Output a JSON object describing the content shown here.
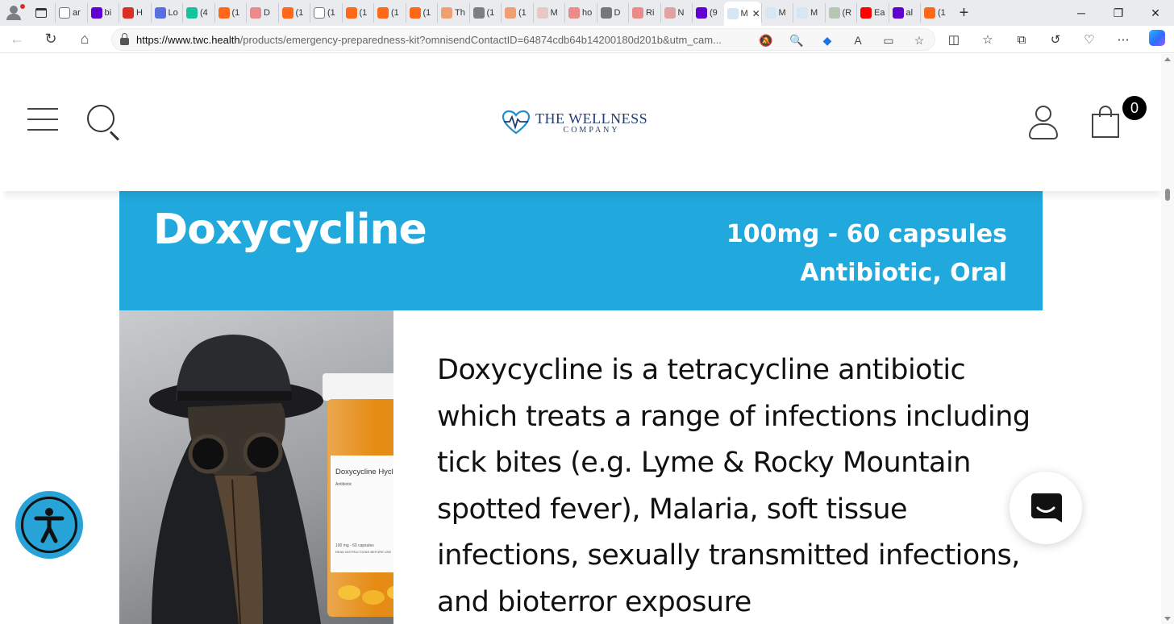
{
  "browser": {
    "tabs": [
      {
        "label": "ar",
        "icon": "document-icon",
        "color": "#ffffff"
      },
      {
        "label": "bi",
        "icon": "yahoo-icon",
        "color": "#6001d2"
      },
      {
        "label": "H",
        "icon": "pocket-icon",
        "color": "#d93025"
      },
      {
        "label": "Lo",
        "icon": "five-icon",
        "color": "#5b6ee1"
      },
      {
        "label": "(4",
        "icon": "g-icon",
        "color": "#15c39a"
      },
      {
        "label": "(1",
        "icon": "substack-icon",
        "color": "#ff6719"
      },
      {
        "label": "D",
        "icon": "youtube-icon",
        "color": "#ea8b8b"
      },
      {
        "label": "(1",
        "icon": "substack-icon",
        "color": "#ff6719"
      },
      {
        "label": "(1",
        "icon": "document-icon",
        "color": "#ffffff"
      },
      {
        "label": "(1",
        "icon": "substack-icon",
        "color": "#ff6719"
      },
      {
        "label": "(1",
        "icon": "substack-icon",
        "color": "#ff6719"
      },
      {
        "label": "(1",
        "icon": "substack-icon",
        "color": "#ff6719"
      },
      {
        "label": "Th",
        "icon": "substack-icon",
        "color": "#f0a070"
      },
      {
        "label": "(1",
        "icon": "image-icon",
        "color": "#7a7f86"
      },
      {
        "label": "(1",
        "icon": "substack-icon",
        "color": "#f0a070"
      },
      {
        "label": "M",
        "icon": "bi-icon",
        "color": "#e6c9c3"
      },
      {
        "label": "ho",
        "icon": "youtube-icon",
        "color": "#ea8b8b"
      },
      {
        "label": "D",
        "icon": "slash-icon",
        "color": "#777777"
      },
      {
        "label": "Ri",
        "icon": "youtube-icon",
        "color": "#ea8b8b"
      },
      {
        "label": "N",
        "icon": "r-icon",
        "color": "#e2a2a2"
      },
      {
        "label": "(9",
        "icon": "mail-icon",
        "color": "#6001d2"
      }
    ],
    "active_tab": {
      "label": "M",
      "icon": "twc-icon"
    },
    "tabs_after": [
      {
        "label": "M",
        "icon": "twc-icon",
        "color": "#d6e6f2"
      },
      {
        "label": "M",
        "icon": "twc-icon",
        "color": "#d6e6f2"
      },
      {
        "label": "(R",
        "icon": "person-icon",
        "color": "#b7c7b5"
      },
      {
        "label": "Ea",
        "icon": "youtube-icon",
        "color": "#ff0000"
      },
      {
        "label": "al",
        "icon": "yahoo-icon",
        "color": "#6001d2"
      },
      {
        "label": "(1",
        "icon": "substack-icon",
        "color": "#ff6719"
      }
    ],
    "url_host": "https://www.twc.health",
    "url_path": "/products/emergency-preparedness-kit?omnisendContactID=64874cdb64b14200180d201b&utm_cam..."
  },
  "site": {
    "logo_name": "THE WELLNESS",
    "logo_sub": "COMPANY",
    "cart_count": "0",
    "brand_color": "#1f3c74"
  },
  "product": {
    "title": "Doxycycline",
    "dose": "100mg - 60 capsules",
    "route": "Antibiotic, Oral",
    "banner_color": "#21a8dc",
    "description": "Doxycycline is a tetracycline antibiotic which treats a range of infections including tick bites (e.g. Lyme & Rocky Mountain spotted fever), Malaria, soft tissue infections, sexually transmitted infections, and bioterror exposure",
    "bottle_label": "Doxycycline Hyclate",
    "bottle_sublabel": "Antibiotic",
    "bottle_small": "100 mg - 60 capsules",
    "bottle_small2": "READ INSTRUCTIONS BEFORE USE"
  }
}
